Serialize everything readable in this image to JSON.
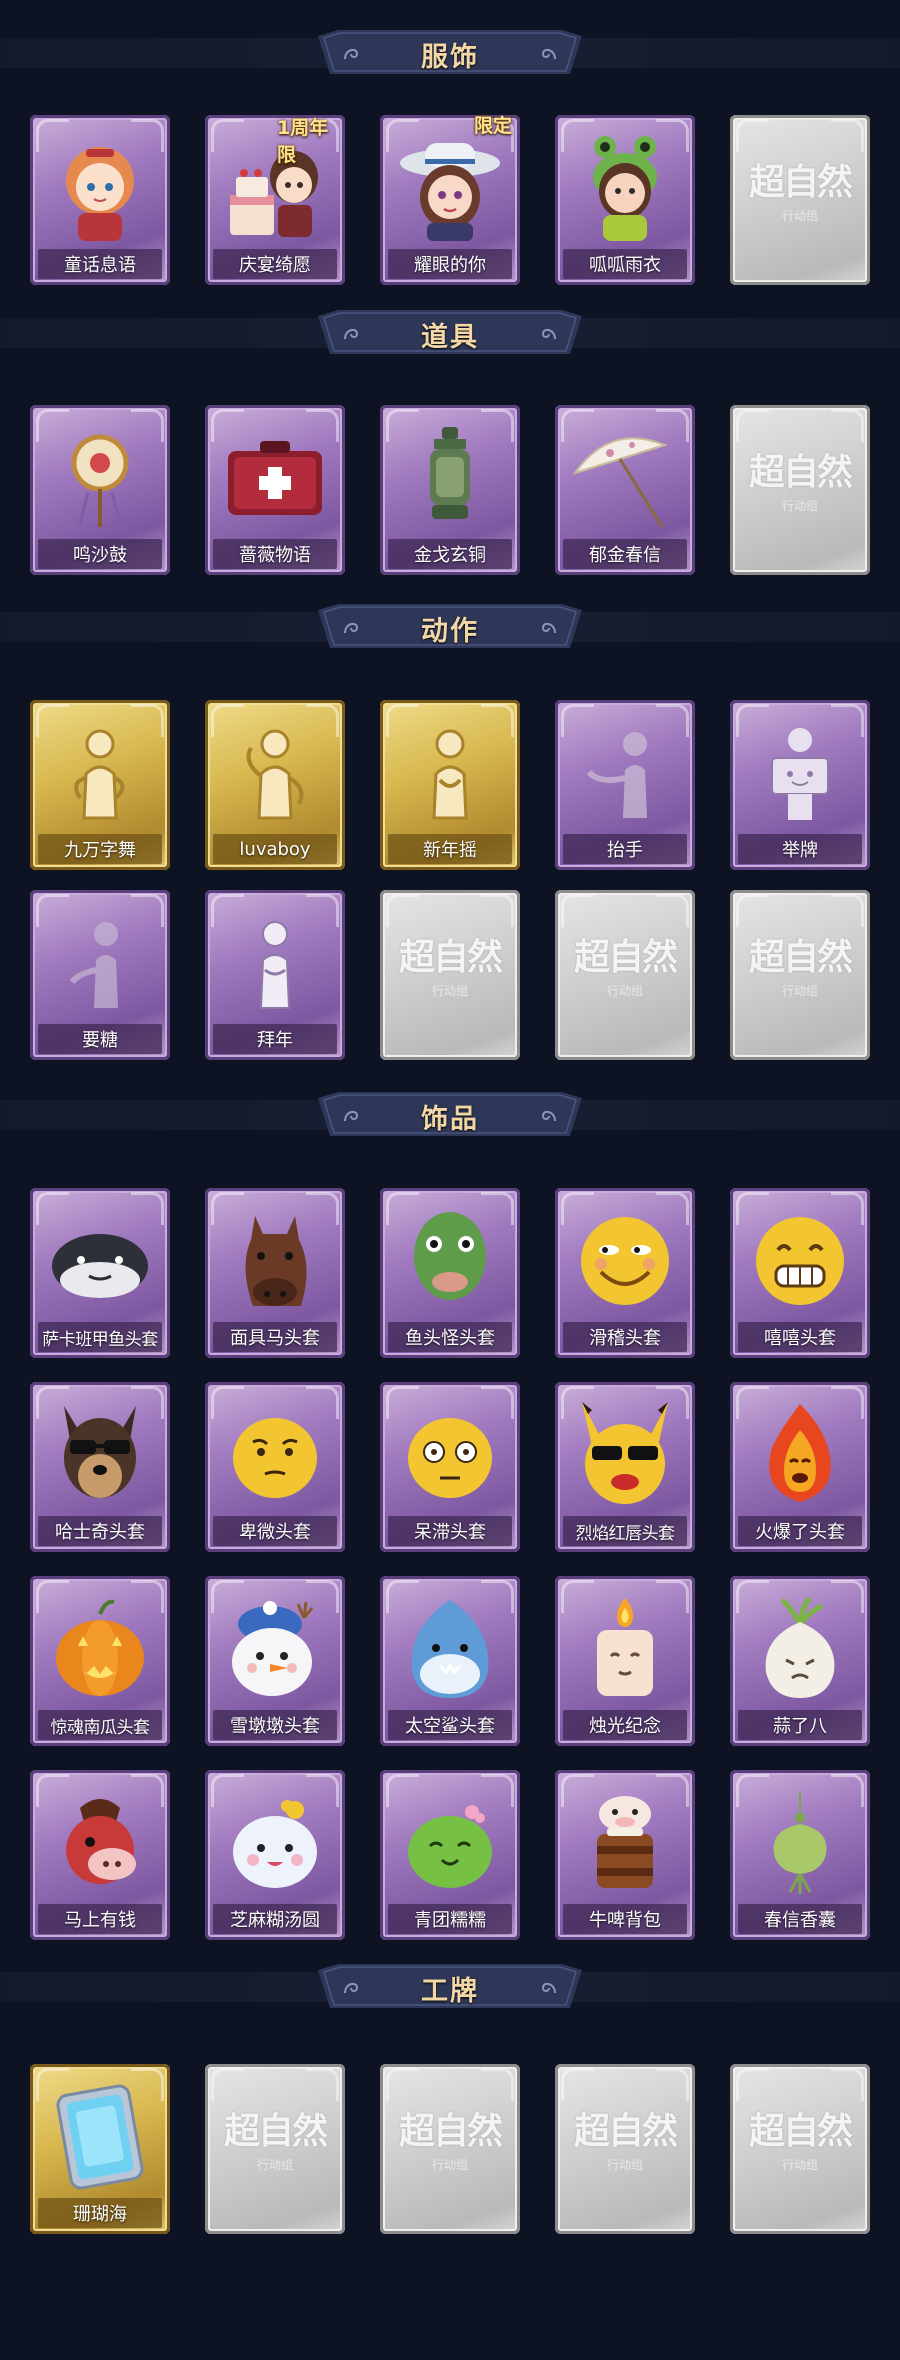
{
  "sections": [
    {
      "title": "服饰",
      "cards": [
        {
          "name": "童话息语",
          "style": "purple",
          "icon": "doll-girl-icon"
        },
        {
          "name": "庆宴绮愿",
          "style": "purple",
          "icon": "cake-girl-icon",
          "badge": "1周年限"
        },
        {
          "name": "耀眼的你",
          "style": "purple",
          "icon": "cowgirl-icon",
          "badge": "限定"
        },
        {
          "name": "呱呱雨衣",
          "style": "purple",
          "icon": "frog-hat-girl-icon"
        },
        {
          "name": "",
          "style": "gray",
          "icon": "locked-watermark-icon"
        }
      ]
    },
    {
      "title": "道具",
      "cards": [
        {
          "name": "鸣沙鼓",
          "style": "purple",
          "icon": "rattle-drum-icon"
        },
        {
          "name": "蔷薇物语",
          "style": "purple",
          "icon": "first-aid-kit-icon"
        },
        {
          "name": "金戈玄铜",
          "style": "purple",
          "icon": "lantern-icon"
        },
        {
          "name": "郁金春信",
          "style": "purple",
          "icon": "umbrella-icon"
        },
        {
          "name": "",
          "style": "gray",
          "icon": "locked-watermark-icon"
        }
      ]
    },
    {
      "title": "动作",
      "cards": [
        {
          "name": "九万字舞",
          "style": "gold",
          "icon": "dance-pose-icon"
        },
        {
          "name": "luvaboy",
          "style": "gold",
          "icon": "dance-pose-icon"
        },
        {
          "name": "新年摇",
          "style": "gold",
          "icon": "dance-pose-icon"
        },
        {
          "name": "抬手",
          "style": "purple",
          "icon": "raise-hand-icon"
        },
        {
          "name": "举牌",
          "style": "purple",
          "icon": "hold-sign-icon"
        },
        {
          "name": "要糖",
          "style": "purple",
          "icon": "ask-candy-icon"
        },
        {
          "name": "拜年",
          "style": "purple",
          "icon": "greeting-pose-icon"
        },
        {
          "name": "",
          "style": "gray",
          "icon": "locked-watermark-icon"
        },
        {
          "name": "",
          "style": "gray",
          "icon": "locked-watermark-icon"
        },
        {
          "name": "",
          "style": "gray",
          "icon": "locked-watermark-icon"
        }
      ]
    },
    {
      "title": "饰品",
      "cards": [
        {
          "name": "萨卡班甲鱼头套",
          "style": "purple",
          "icon": "fish-head-icon"
        },
        {
          "name": "面具马头套",
          "style": "purple",
          "icon": "horse-head-icon"
        },
        {
          "name": "鱼头怪头套",
          "style": "purple",
          "icon": "fishman-head-icon"
        },
        {
          "name": "滑稽头套",
          "style": "purple",
          "icon": "funny-face-icon"
        },
        {
          "name": "嘻嘻头套",
          "style": "purple",
          "icon": "grin-face-icon"
        },
        {
          "name": "哈士奇头套",
          "style": "purple",
          "icon": "husky-head-icon"
        },
        {
          "name": "卑微头套",
          "style": "purple",
          "icon": "humble-face-icon"
        },
        {
          "name": "呆滞头套",
          "style": "purple",
          "icon": "dazed-face-icon"
        },
        {
          "name": "烈焰红唇头套",
          "style": "purple",
          "icon": "pikachu-head-icon"
        },
        {
          "name": "火爆了头套",
          "style": "purple",
          "icon": "fire-face-icon"
        },
        {
          "name": "惊魂南瓜头套",
          "style": "purple",
          "icon": "pumpkin-head-icon"
        },
        {
          "name": "雪墩墩头套",
          "style": "purple",
          "icon": "snowman-head-icon"
        },
        {
          "name": "太空鲨头套",
          "style": "purple",
          "icon": "shark-head-icon"
        },
        {
          "name": "烛光纪念",
          "style": "purple",
          "icon": "candle-icon"
        },
        {
          "name": "蒜了八",
          "style": "purple",
          "icon": "garlic-icon"
        },
        {
          "name": "马上有钱",
          "style": "purple",
          "icon": "red-horse-icon"
        },
        {
          "name": "芝麻糊汤圆",
          "style": "purple",
          "icon": "rice-ball-icon"
        },
        {
          "name": "青团糯糯",
          "style": "purple",
          "icon": "green-dumpling-icon"
        },
        {
          "name": "牛啤背包",
          "style": "purple",
          "icon": "cow-backpack-icon"
        },
        {
          "name": "春信香囊",
          "style": "purple",
          "icon": "sachet-icon"
        }
      ]
    },
    {
      "title": "工牌",
      "cards": [
        {
          "name": "珊瑚海",
          "style": "gold",
          "icon": "coral-badge-icon"
        },
        {
          "name": "",
          "style": "gray",
          "icon": "locked-watermark-icon"
        },
        {
          "name": "",
          "style": "gray",
          "icon": "locked-watermark-icon"
        },
        {
          "name": "",
          "style": "gray",
          "icon": "locked-watermark-icon"
        },
        {
          "name": "",
          "style": "gray",
          "icon": "locked-watermark-icon"
        }
      ]
    }
  ],
  "watermark": {
    "main": "超自然",
    "sub": "行动组"
  },
  "colors": {
    "background": "#0d1322",
    "banner": "#2e3758",
    "banner_text": "#f3d8a6",
    "purple": "#a27cc0",
    "gold": "#d8b850",
    "gray": "#cfcfcf"
  }
}
